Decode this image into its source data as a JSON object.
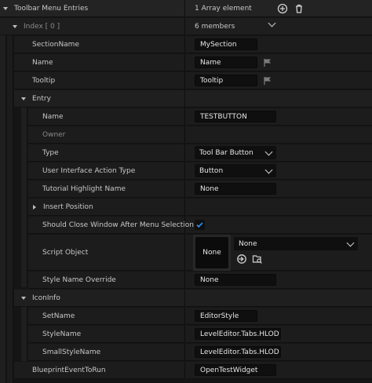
{
  "header": {
    "title": "Toolbar Menu Entries",
    "count": "1 Array element"
  },
  "index_row": {
    "label": "Index [ 0 ]",
    "members": "6 members"
  },
  "section_name": {
    "label": "SectionName",
    "value": "MySection"
  },
  "name": {
    "label": "Name",
    "value": "Name"
  },
  "tooltip": {
    "label": "Tooltip",
    "value": "Tooltip"
  },
  "entry": {
    "label": "Entry",
    "name": {
      "label": "Name",
      "value": "TESTBUTTON"
    },
    "owner": {
      "label": "Owner"
    },
    "type": {
      "label": "Type",
      "value": "Tool Bar Button"
    },
    "ui_action_type": {
      "label": "User Interface Action Type",
      "value": "Button"
    },
    "tutorial": {
      "label": "Tutorial Highlight Name",
      "value": "None"
    },
    "insert_position": {
      "label": "Insert Position"
    },
    "close_window": {
      "label": "Should Close Window After Menu Selection",
      "checked": true
    },
    "script_object": {
      "label": "Script Object",
      "thumb": "None",
      "value": "None"
    },
    "style_override": {
      "label": "Style Name Override",
      "value": "None"
    }
  },
  "icon_info": {
    "label": "IconInfo",
    "set_name": {
      "label": "SetName",
      "value": "EditorStyle"
    },
    "style_name": {
      "label": "StyleName",
      "value": "LevelEditor.Tabs.HLOD"
    },
    "small_style_name": {
      "label": "SmallStyleName",
      "value": "LevelEditor.Tabs.HLOD"
    }
  },
  "blueprint_event": {
    "label": "BlueprintEventToRun",
    "value": "OpenTestWidget"
  },
  "colors": {
    "accent": "#2e8de6",
    "panel": "#151515",
    "field": "#0f0f0f"
  }
}
